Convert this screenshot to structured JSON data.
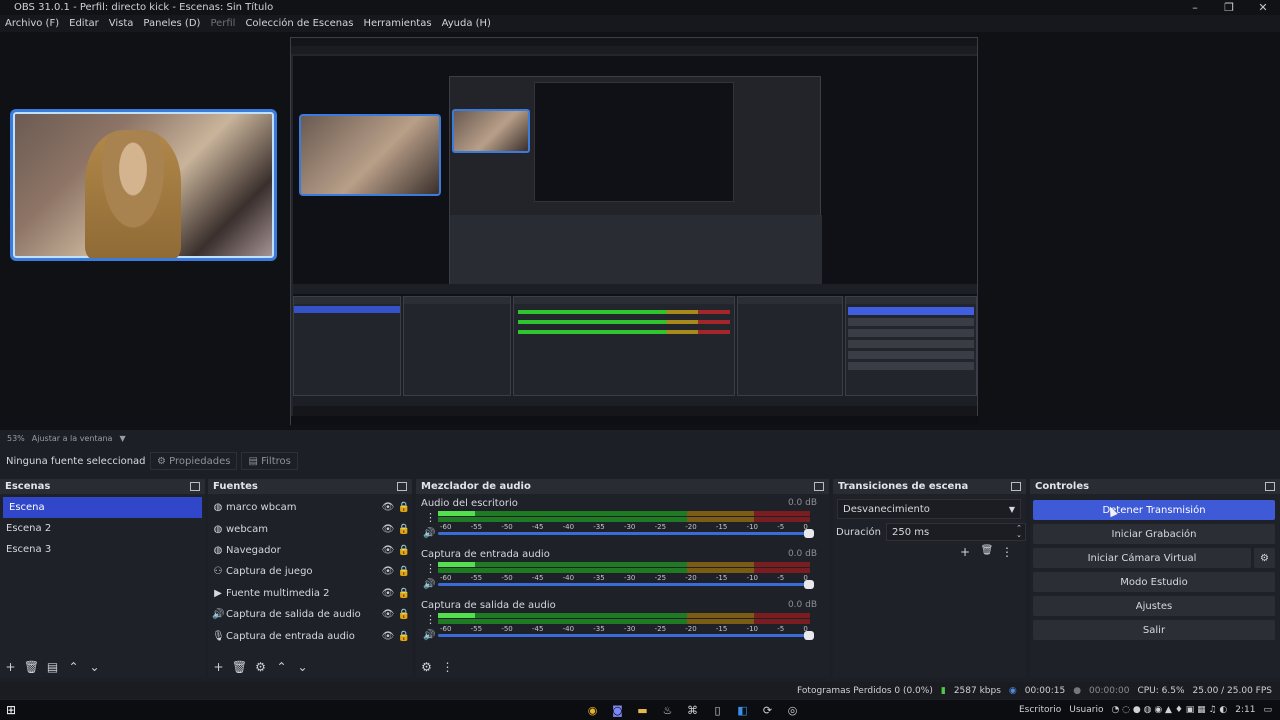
{
  "window": {
    "title": "OBS 31.0.1 - Perfil: directo kick - Escenas: Sin Título"
  },
  "menu": [
    {
      "label": "Archivo (F)",
      "enabled": true
    },
    {
      "label": "Editar",
      "enabled": true
    },
    {
      "label": "Vista",
      "enabled": true
    },
    {
      "label": "Paneles (D)",
      "enabled": true
    },
    {
      "label": "Perfil",
      "enabled": false
    },
    {
      "label": "Colección de Escenas",
      "enabled": true
    },
    {
      "label": "Herramientas",
      "enabled": true
    },
    {
      "label": "Ayuda (H)",
      "enabled": true
    }
  ],
  "preview": {
    "zoom": "53%",
    "fit_label": "Ajustar a la ventana"
  },
  "source_toolbar": {
    "no_source": "Ninguna fuente seleccionad",
    "properties": "Propiedades",
    "filters": "Filtros"
  },
  "scenes": {
    "title": "Escenas",
    "items": [
      {
        "label": "Escena",
        "selected": true
      },
      {
        "label": "Escena 2",
        "selected": false
      },
      {
        "label": "Escena 3",
        "selected": false
      }
    ]
  },
  "sources": {
    "title": "Fuentes",
    "items": [
      {
        "label": "marco wbcam",
        "icon": "globe-icon"
      },
      {
        "label": "webcam",
        "icon": "globe-icon"
      },
      {
        "label": "Navegador",
        "icon": "globe-icon"
      },
      {
        "label": "Captura de juego",
        "icon": "gamepad-icon"
      },
      {
        "label": "Fuente multimedia 2",
        "icon": "play-icon"
      },
      {
        "label": "Captura de salida de audio",
        "icon": "speaker-icon"
      },
      {
        "label": "Captura de entrada audio",
        "icon": "microphone-icon"
      }
    ]
  },
  "mixer": {
    "title": "Mezclador de audio",
    "ticks": [
      "-60",
      "-55",
      "-50",
      "-45",
      "-40",
      "-35",
      "-30",
      "-25",
      "-20",
      "-15",
      "-10",
      "-5",
      "0"
    ],
    "channels": [
      {
        "name": "Audio del escritorio",
        "db": "0.0 dB",
        "volume": 1.0
      },
      {
        "name": "Captura de entrada audio",
        "db": "0.0 dB",
        "volume": 1.0
      },
      {
        "name": "Captura de salida de audio",
        "db": "0.0 dB",
        "volume": 1.0
      }
    ]
  },
  "transitions": {
    "title": "Transiciones de escena",
    "selected": "Desvanecimiento",
    "duration_label": "Duración",
    "duration_value": "250 ms"
  },
  "controls": {
    "title": "Controles",
    "stop_stream": "Detener Transmisión",
    "start_recording": "Iniciar Grabación",
    "virtual_cam": "Iniciar Cámara Virtual",
    "studio_mode": "Modo Estudio",
    "settings": "Ajustes",
    "exit": "Salir"
  },
  "status": {
    "dropped": "Fotogramas Perdidos 0 (0.0%)",
    "bitrate": "2587 kbps",
    "stream_time": "00:00:15",
    "rec_time": "00:00:00",
    "cpu": "CPU: 6.5%",
    "fps": "25.00 / 25.00 FPS"
  },
  "taskbar": {
    "desktop": "Escritorio",
    "user": "Usuario",
    "time": "2:11"
  },
  "colors": {
    "accent": "#3e5ad6",
    "selection": "#2f47c8",
    "meter_green": "#54e04e",
    "meter_yellow": "#a68a1c",
    "meter_red": "#a3262a"
  }
}
